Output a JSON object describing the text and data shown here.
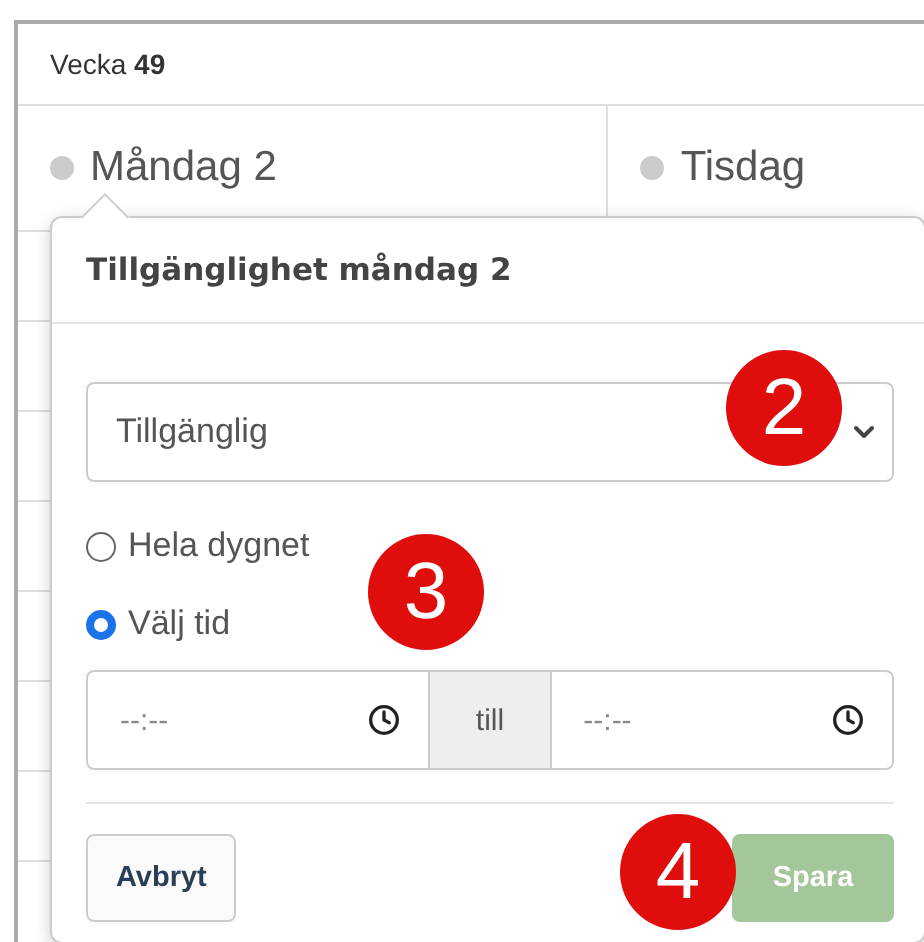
{
  "week": {
    "label": "Vecka",
    "number": "49"
  },
  "days": [
    {
      "label": "Måndag 2"
    },
    {
      "label": "Tisdag"
    }
  ],
  "popover": {
    "title": "Tillgänglighet måndag 2",
    "select": {
      "value": "Tillgänglig"
    },
    "radios": [
      {
        "label": "Hela dygnet",
        "selected": false
      },
      {
        "label": "Välj tid",
        "selected": true
      }
    ],
    "time": {
      "from_placeholder": "--:--",
      "separator": "till",
      "to_placeholder": "--:--"
    },
    "cancel": {
      "label": "Avbryt"
    },
    "save": {
      "label": "Spara",
      "disabled": true
    }
  },
  "markers": [
    "2",
    "3",
    "4"
  ]
}
